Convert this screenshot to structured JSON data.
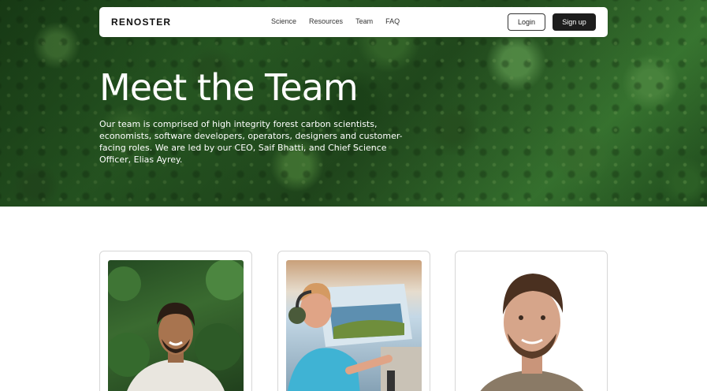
{
  "brand": {
    "logo": "RENOSTER"
  },
  "nav": {
    "links": [
      "Science",
      "Resources",
      "Team",
      "FAQ"
    ],
    "login_label": "Login",
    "signup_label": "Sign up"
  },
  "hero": {
    "title": "Meet the Team",
    "description": "Our team is comprised of high integrity forest carbon scientists, economists, software developers, operators, designers and customer-facing roles. We are led by our CEO, Saif Bhatti, and Chief Science Officer, Elias Ayrey."
  },
  "team": {
    "cards": [
      {
        "photo": "portrait-man-forest-background"
      },
      {
        "photo": "portrait-pilot-in-cockpit"
      },
      {
        "photo": "portrait-man-white-background"
      }
    ]
  },
  "colors": {
    "forest_dark": "#1e4a1a",
    "forest_light": "#4f8a3e",
    "button_dark": "#1d1d1d",
    "card_border": "#d6d6d6"
  }
}
